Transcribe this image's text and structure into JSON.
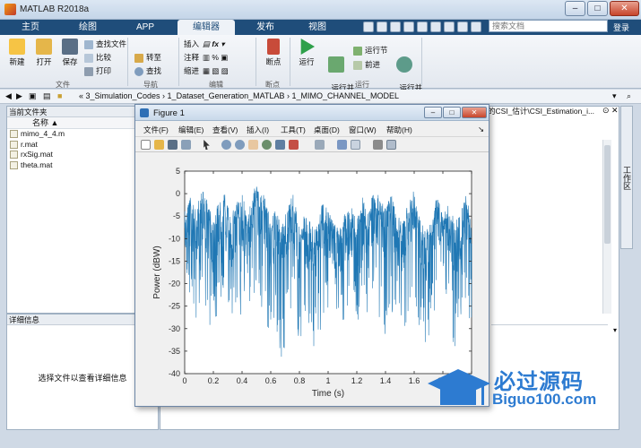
{
  "window": {
    "title": "MATLAB R2018a"
  },
  "ribbon_tabs": [
    "主页",
    "绘图",
    "APP",
    "编辑器",
    "发布",
    "视图"
  ],
  "search": {
    "placeholder": "搜索文档",
    "login": "登录"
  },
  "ribbon": {
    "big_buttons": [
      "新建",
      "打开",
      "保存",
      "断点",
      "运行",
      "运行并\n前进",
      "运行并\n计时"
    ],
    "file_small": [
      "查找文件",
      "比较",
      "打印"
    ],
    "nav_small": [
      "转至",
      "查找"
    ],
    "edit_small": [
      "插入",
      "注释",
      "缩进"
    ],
    "run_small": [
      "运行节",
      "前进"
    ],
    "groups": [
      "文件",
      "导航",
      "编辑",
      "断点",
      "运行"
    ]
  },
  "address": {
    "path": "«  3_Simulation_Codes  ›  1_Dataset_Generation_MATLAB  ›  1_MIMO_CHANNEL_MODEL"
  },
  "left_panel": {
    "header": "当前文件夹",
    "column": "名称",
    "files": [
      "mimo_4_4.m",
      "r.mat",
      "rxSig.mat",
      "theta.mat"
    ]
  },
  "details": {
    "header": "详细信息",
    "message": "选择文件以查看详细信息"
  },
  "right_crumb": "的CSI_估计\\CSI_Estimation_i...",
  "side_tab": "工作区",
  "figure": {
    "title": "Figure 1",
    "menu": [
      "文件(F)",
      "编辑(E)",
      "查看(V)",
      "插入(I)",
      "工具(T)",
      "桌面(D)",
      "窗口(W)",
      "帮助(H)"
    ]
  },
  "chart_data": {
    "type": "line",
    "xlabel": "Time (s)",
    "ylabel": "Power (dBW)",
    "xlim": [
      0,
      2
    ],
    "ylim": [
      -40,
      5
    ],
    "xticks": [
      "0",
      "0.2",
      "0.4",
      "0.6",
      "0.8",
      "1",
      "1.2",
      "1.4",
      "1.6",
      "1.8",
      "2"
    ],
    "yticks": [
      "5",
      "0",
      "-5",
      "-10",
      "-15",
      "-20",
      "-25",
      "-30",
      "-35",
      "-40"
    ],
    "color": "#1f77b4",
    "envelope_x": [
      0,
      0.04,
      0.08,
      0.12,
      0.16,
      0.2,
      0.24,
      0.28,
      0.32,
      0.36,
      0.4,
      0.44,
      0.48,
      0.52,
      0.56,
      0.6,
      0.64,
      0.68,
      0.72,
      0.76,
      0.8,
      0.84,
      0.88,
      0.92,
      0.96,
      1.0,
      1.04,
      1.08,
      1.12,
      1.16,
      1.2,
      1.24,
      1.28,
      1.32,
      1.36,
      1.4,
      1.44,
      1.48,
      1.52,
      1.56,
      1.6,
      1.64,
      1.68,
      1.72,
      1.76,
      1.8,
      1.84,
      1.88,
      1.92,
      1.96,
      2.0
    ],
    "envelope_y": [
      -3,
      0,
      -4,
      2,
      -2,
      -6,
      -1,
      0,
      -5,
      -2,
      0,
      -5,
      1,
      2,
      -1,
      -6,
      -3,
      -7,
      -2,
      0,
      -8,
      -4,
      -6,
      -7,
      -1,
      -4,
      -6,
      -8,
      -4,
      -2,
      -6,
      0,
      -5,
      2,
      -1,
      -3,
      0,
      -4,
      -6,
      -2,
      1,
      -5,
      -8,
      -4,
      0,
      -5,
      -2,
      -6,
      -5,
      0,
      -4
    ],
    "floor_y": [
      -25,
      -22,
      -30,
      -20,
      -28,
      -33,
      -25,
      -20,
      -27,
      -31,
      -26,
      -22,
      -29,
      -24,
      -27,
      -34,
      -30,
      -38,
      -29,
      -25,
      -35,
      -28,
      -33,
      -38,
      -27,
      -30,
      -25,
      -29,
      -33,
      -26,
      -30,
      -22,
      -28,
      -25,
      -30,
      -35,
      -27,
      -25,
      -33,
      -28,
      -24,
      -32,
      -38,
      -28,
      -24,
      -30,
      -22,
      -36,
      -28,
      -25,
      -30
    ]
  },
  "watermark": {
    "cn": "必过源码",
    "en": "Biguo100.com"
  }
}
